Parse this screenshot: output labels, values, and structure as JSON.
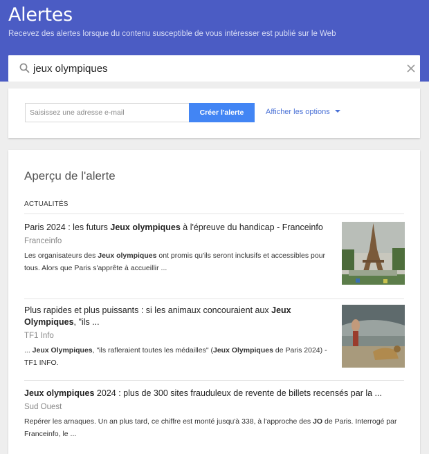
{
  "header": {
    "title": "Alertes",
    "subtitle": "Recevez des alertes lorsque du contenu susceptible de vous intéresser est publié sur le Web"
  },
  "search": {
    "value": "jeux olympiques",
    "icon": "search-icon",
    "clear_icon": "close-icon"
  },
  "form": {
    "email_placeholder": "Saisissez une adresse e-mail",
    "create_button": "Créer l'alerte",
    "options_link": "Afficher les options"
  },
  "preview": {
    "title": "Aperçu de l'alerte",
    "section": "ACTUALITÉS",
    "items": [
      {
        "title_parts": [
          {
            "text": "Paris 2024 : les futurs ",
            "bold": false
          },
          {
            "text": "Jeux olympiques",
            "bold": true
          },
          {
            "text": " à l'épreuve du handicap - Franceinfo",
            "bold": false
          }
        ],
        "source": "Franceinfo",
        "snippet_parts": [
          {
            "text": "Les organisateurs des ",
            "bold": false
          },
          {
            "text": "Jeux olympiques",
            "bold": true
          },
          {
            "text": " ont promis qu'ils seront inclusifs et accessibles pour tous. Alors que Paris s'apprête à accueillir ...",
            "bold": false
          }
        ],
        "thumbnail": "eiffel-tower-photo"
      },
      {
        "title_parts": [
          {
            "text": "Plus rapides et plus puissants : si les animaux concouraient aux ",
            "bold": false
          },
          {
            "text": "Jeux Olympiques",
            "bold": true
          },
          {
            "text": ", \"ils ...",
            "bold": false
          }
        ],
        "source": "TF1 Info",
        "snippet_parts": [
          {
            "text": "... ",
            "bold": false
          },
          {
            "text": "Jeux Olympiques",
            "bold": true
          },
          {
            "text": ", \"ils rafleraient toutes les médailles\" (",
            "bold": false
          },
          {
            "text": "Jeux Olympiques",
            "bold": true
          },
          {
            "text": " de Paris 2024) - TF1 INFO.",
            "bold": false
          }
        ],
        "thumbnail": "athlete-and-cheetah-photo"
      },
      {
        "title_parts": [
          {
            "text": "Jeux olympiques",
            "bold": true
          },
          {
            "text": " 2024 : plus de 300 sites frauduleux de revente de billets recensés par la ...",
            "bold": false
          }
        ],
        "source": "Sud Ouest",
        "snippet_parts": [
          {
            "text": "Repérer les arnaques. Un an plus tard, ce chiffre est monté jusqu'à 338, à l'approche des ",
            "bold": false
          },
          {
            "text": "JO",
            "bold": true
          },
          {
            "text": " de Paris. Interrogé par Franceinfo, le ...",
            "bold": false
          }
        ],
        "thumbnail": null
      }
    ]
  },
  "colors": {
    "header": "#4b5cc4",
    "button": "#4285f4",
    "link": "#4a71d6"
  }
}
